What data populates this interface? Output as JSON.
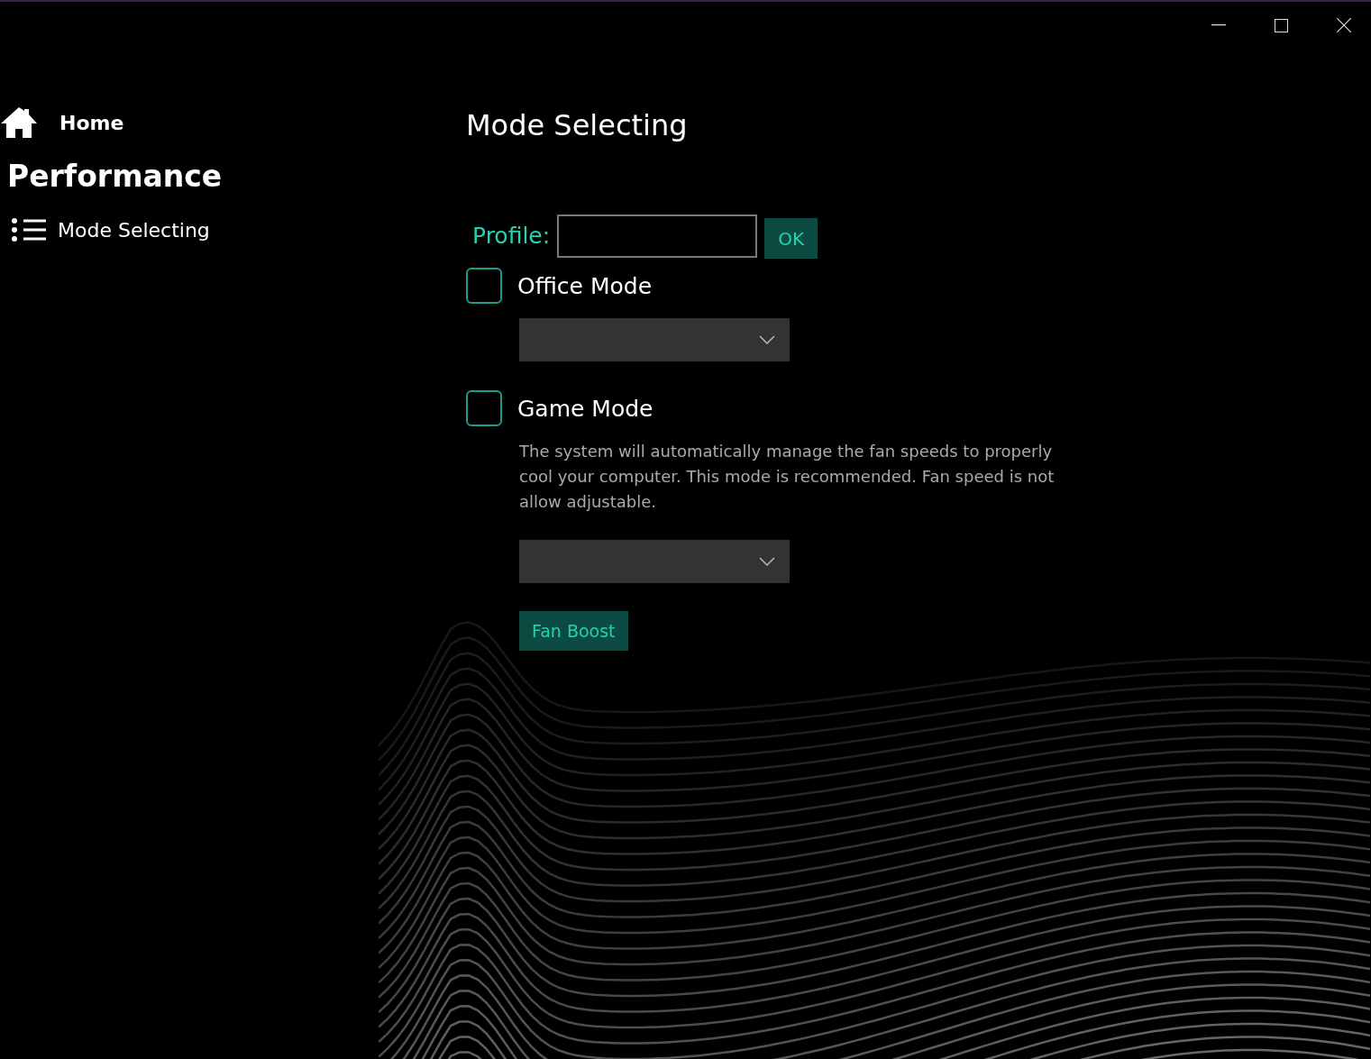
{
  "sidebar": {
    "home": {
      "label": "Home"
    },
    "section": "Performance",
    "items": [
      {
        "label": "Mode Selecting"
      }
    ]
  },
  "main": {
    "title": "Mode Selecting",
    "profile": {
      "label": "Profile:",
      "button": "OK"
    },
    "modes": [
      {
        "label": "Office Mode",
        "checked": false
      },
      {
        "label": "Game Mode",
        "checked": false,
        "description": "The system will automatically manage the fan speeds to properly cool your computer.  This mode is recommended. Fan speed is not allow adjustable."
      }
    ],
    "fan_boost_button": "Fan Boost"
  }
}
